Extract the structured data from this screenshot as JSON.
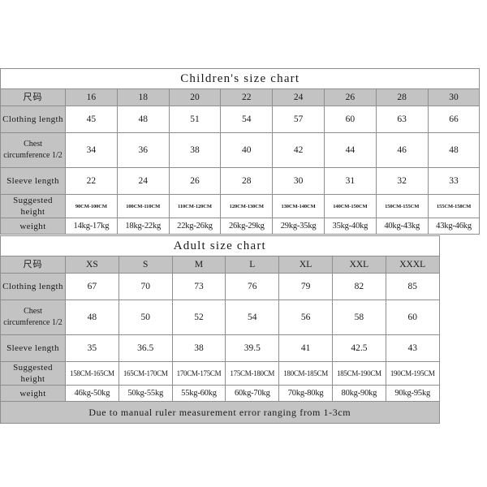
{
  "children_chart": {
    "title": "Children's size chart",
    "size_label": "尺码",
    "sizes": [
      "16",
      "18",
      "20",
      "22",
      "24",
      "26",
      "28",
      "30"
    ],
    "rows": [
      {
        "label": "Clothing length",
        "values": [
          "45",
          "48",
          "51",
          "54",
          "57",
          "60",
          "63",
          "66"
        ]
      },
      {
        "label": "Chest circumference 1/2",
        "values": [
          "34",
          "36",
          "38",
          "40",
          "42",
          "44",
          "46",
          "48"
        ]
      },
      {
        "label": "Sleeve length",
        "values": [
          "22",
          "24",
          "26",
          "28",
          "30",
          "31",
          "32",
          "33"
        ]
      },
      {
        "label": "Suggested height",
        "values": [
          "90CM-100CM",
          "100CM-110CM",
          "110CM-120CM",
          "120CM-130CM",
          "130CM-140CM",
          "140CM-150CM",
          "150CM-155CM",
          "155CM-158CM"
        ]
      },
      {
        "label": "weight",
        "values": [
          "14kg-17kg",
          "18kg-22kg",
          "22kg-26kg",
          "26kg-29kg",
          "29kg-35kg",
          "35kg-40kg",
          "40kg-43kg",
          "43kg-46kg"
        ]
      }
    ]
  },
  "adult_chart": {
    "title": "Adult size chart",
    "size_label": "尺码",
    "sizes": [
      "XS",
      "S",
      "M",
      "L",
      "XL",
      "XXL",
      "XXXL"
    ],
    "rows": [
      {
        "label": "Clothing length",
        "values": [
          "67",
          "70",
          "73",
          "76",
          "79",
          "82",
          "85"
        ]
      },
      {
        "label": "Chest circumference 1/2",
        "values": [
          "48",
          "50",
          "52",
          "54",
          "56",
          "58",
          "60"
        ]
      },
      {
        "label": "Sleeve length",
        "values": [
          "35",
          "36.5",
          "38",
          "39.5",
          "41",
          "42.5",
          "43"
        ]
      },
      {
        "label": "Suggested height",
        "values": [
          "158CM-165CM",
          "165CM-170CM",
          "170CM-175CM",
          "175CM-180CM",
          "180CM-185CM",
          "185CM-190CM",
          "190CM-195CM"
        ]
      },
      {
        "label": "weight",
        "values": [
          "46kg-50kg",
          "50kg-55kg",
          "55kg-60kg",
          "60kg-70kg",
          "70kg-80kg",
          "80kg-90kg",
          "90kg-95kg"
        ]
      }
    ],
    "note": "Due to manual ruler measurement error ranging from 1-3cm"
  },
  "colors": {
    "header_gray": "#c3c3c3",
    "border": "#8e8e8e",
    "background": "#ffffff",
    "text": "#1a1a1a"
  }
}
